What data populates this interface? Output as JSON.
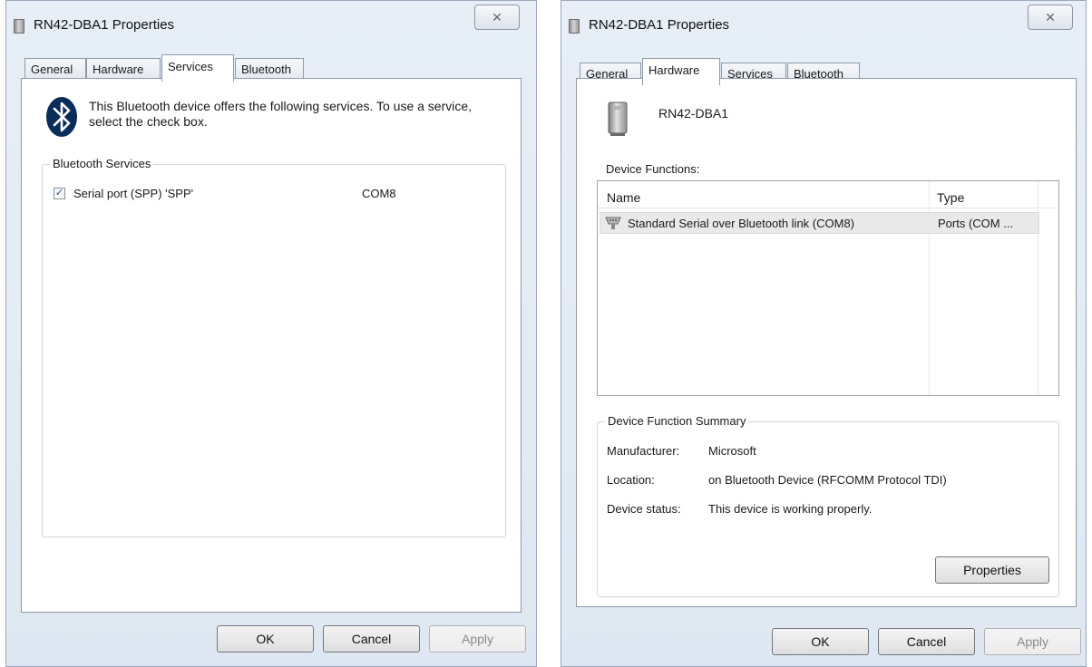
{
  "left_dialog": {
    "title": "RN42-DBA1 Properties",
    "close_label": "✕",
    "tabs": [
      "General",
      "Hardware",
      "Services",
      "Bluetooth"
    ],
    "intro_text": "This Bluetooth device offers the following services. To use a service, select the check box.",
    "group_label": "Bluetooth Services",
    "service": {
      "name": "Serial port (SPP) 'SPP'",
      "port": "COM8",
      "checked": true
    },
    "buttons": {
      "ok": "OK",
      "cancel": "Cancel",
      "apply": "Apply"
    }
  },
  "right_dialog": {
    "title": "RN42-DBA1 Properties",
    "close_label": "✕",
    "tabs": [
      "General",
      "Hardware",
      "Services",
      "Bluetooth"
    ],
    "device_name": "RN42-DBA1",
    "functions_label": "Device Functions:",
    "columns": [
      "Name",
      "Type"
    ],
    "rows": [
      {
        "name": "Standard Serial over Bluetooth link (COM8)",
        "type": "Ports (COM ..."
      }
    ],
    "summary_label": "Device Function Summary",
    "summary": {
      "manufacturer_key": "Manufacturer:",
      "manufacturer_value": "Microsoft",
      "location_key": "Location:",
      "location_value": "on Bluetooth Device (RFCOMM Protocol TDI)",
      "status_key": "Device status:",
      "status_value": "This device is working properly."
    },
    "properties_button": "Properties",
    "buttons": {
      "ok": "OK",
      "cancel": "Cancel",
      "apply": "Apply"
    }
  },
  "colors": {
    "bluetooth_icon": "#0a2c5a",
    "selected_row": "#e9e9e9"
  },
  "icons": [
    "bluetooth-icon",
    "device-icon",
    "port-icon",
    "close-icon",
    "checkbox-checked"
  ]
}
